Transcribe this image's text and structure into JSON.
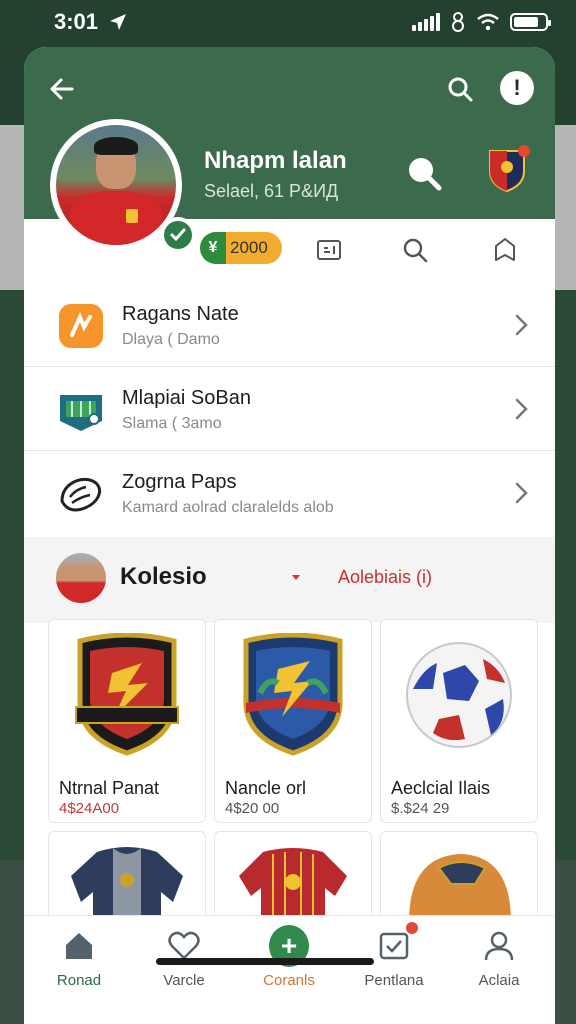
{
  "status_bar": {
    "time": "3:01"
  },
  "profile": {
    "name": "Nhapm lalan",
    "subtitle": "Selael, 61 P&ИД"
  },
  "quick_row": {
    "points": "2000"
  },
  "list": [
    {
      "title": "Ragans Nate",
      "subtitle": "Dlaya ( Damo",
      "icon": "orange-app-icon"
    },
    {
      "title": "Mlapiai SoBan",
      "subtitle": "Slama ( 3amo",
      "icon": "stadium-icon"
    },
    {
      "title": "Zogrna Paps",
      "subtitle": "Kamard aolrad claralelds alob",
      "icon": "cleat-icon"
    }
  ],
  "collection": {
    "title": "Kolesio",
    "link": "Aolebiais (i)"
  },
  "products": [
    {
      "name": "Ntrnal Panat",
      "price": "4$24A00",
      "image": "crest-red-icon"
    },
    {
      "name": "Nancle orl",
      "price": "4$20 00",
      "image": "crest-blue-icon"
    },
    {
      "name": "Aeclcial Ilais",
      "price": "$.$24 29",
      "image": "football-icon"
    },
    {
      "name": "",
      "price": "",
      "image": "jacket-icon"
    },
    {
      "name": "",
      "price": "",
      "image": "jersey-icon"
    },
    {
      "name": "",
      "price": "",
      "image": "helmet-icon"
    }
  ],
  "nav": [
    {
      "label": "Ronad",
      "icon": "home-icon"
    },
    {
      "label": "Varcle",
      "icon": "heart-icon"
    },
    {
      "label": "Coranls",
      "icon": "plus-icon"
    },
    {
      "label": "Pentlana",
      "icon": "checkbox-icon"
    },
    {
      "label": "Aclaia",
      "icon": "user-icon"
    }
  ],
  "colors": {
    "header_green": "#3b6b4c",
    "accent_green": "#2f8a4c",
    "points_orange": "#f4ac2f",
    "price_red": "#c23b3b",
    "link_red": "#c9302c"
  }
}
